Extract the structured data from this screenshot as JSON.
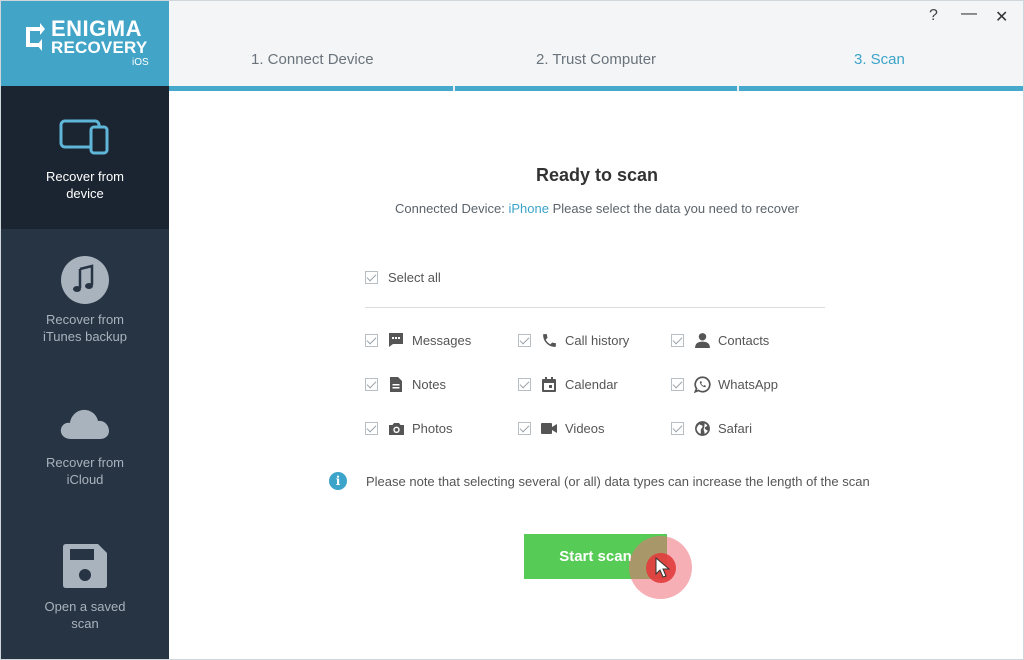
{
  "logo": {
    "line1": "ENIGMA",
    "line2": "RECOVERY",
    "line3": "iOS"
  },
  "window": {
    "help": "?",
    "minimize": "—",
    "close": "✕"
  },
  "steps": [
    {
      "label": "1. Connect Device"
    },
    {
      "label": "2. Trust Computer"
    },
    {
      "label": "3. Scan"
    }
  ],
  "sidebar": {
    "items": [
      {
        "line1": "Recover from",
        "line2": "device",
        "icon": "devices-icon"
      },
      {
        "line1": "Recover from",
        "line2": "iTunes backup",
        "icon": "music-note-icon"
      },
      {
        "line1": "Recover from",
        "line2": "iCloud",
        "icon": "cloud-icon"
      },
      {
        "line1": "Open a saved",
        "line2": "scan",
        "icon": "floppy-disk-icon"
      }
    ]
  },
  "main": {
    "title": "Ready to scan",
    "subtitle_prefix": "Connected Device:",
    "device": "iPhone",
    "subtitle_suffix": "Please select the data you need to recover",
    "select_all": "Select all",
    "options": [
      {
        "label": "Messages",
        "icon": "chat-icon"
      },
      {
        "label": "Call history",
        "icon": "phone-icon"
      },
      {
        "label": "Contacts",
        "icon": "person-icon"
      },
      {
        "label": "Notes",
        "icon": "document-icon"
      },
      {
        "label": "Calendar",
        "icon": "calendar-icon"
      },
      {
        "label": "WhatsApp",
        "icon": "whatsapp-icon"
      },
      {
        "label": "Photos",
        "icon": "camera-icon"
      },
      {
        "label": "Videos",
        "icon": "video-camera-icon"
      },
      {
        "label": "Safari",
        "icon": "globe-icon"
      }
    ],
    "note_icon": "i",
    "note": "Please note that selecting several (or all) data types can increase the length of the scan",
    "start_button": "Start scan"
  },
  "colors": {
    "accent": "#3ca3c9",
    "logo_bg": "#42a5c8",
    "sidebar_bg": "#263444",
    "sidebar_active": "#1b2532",
    "button_green": "#56cb55"
  }
}
